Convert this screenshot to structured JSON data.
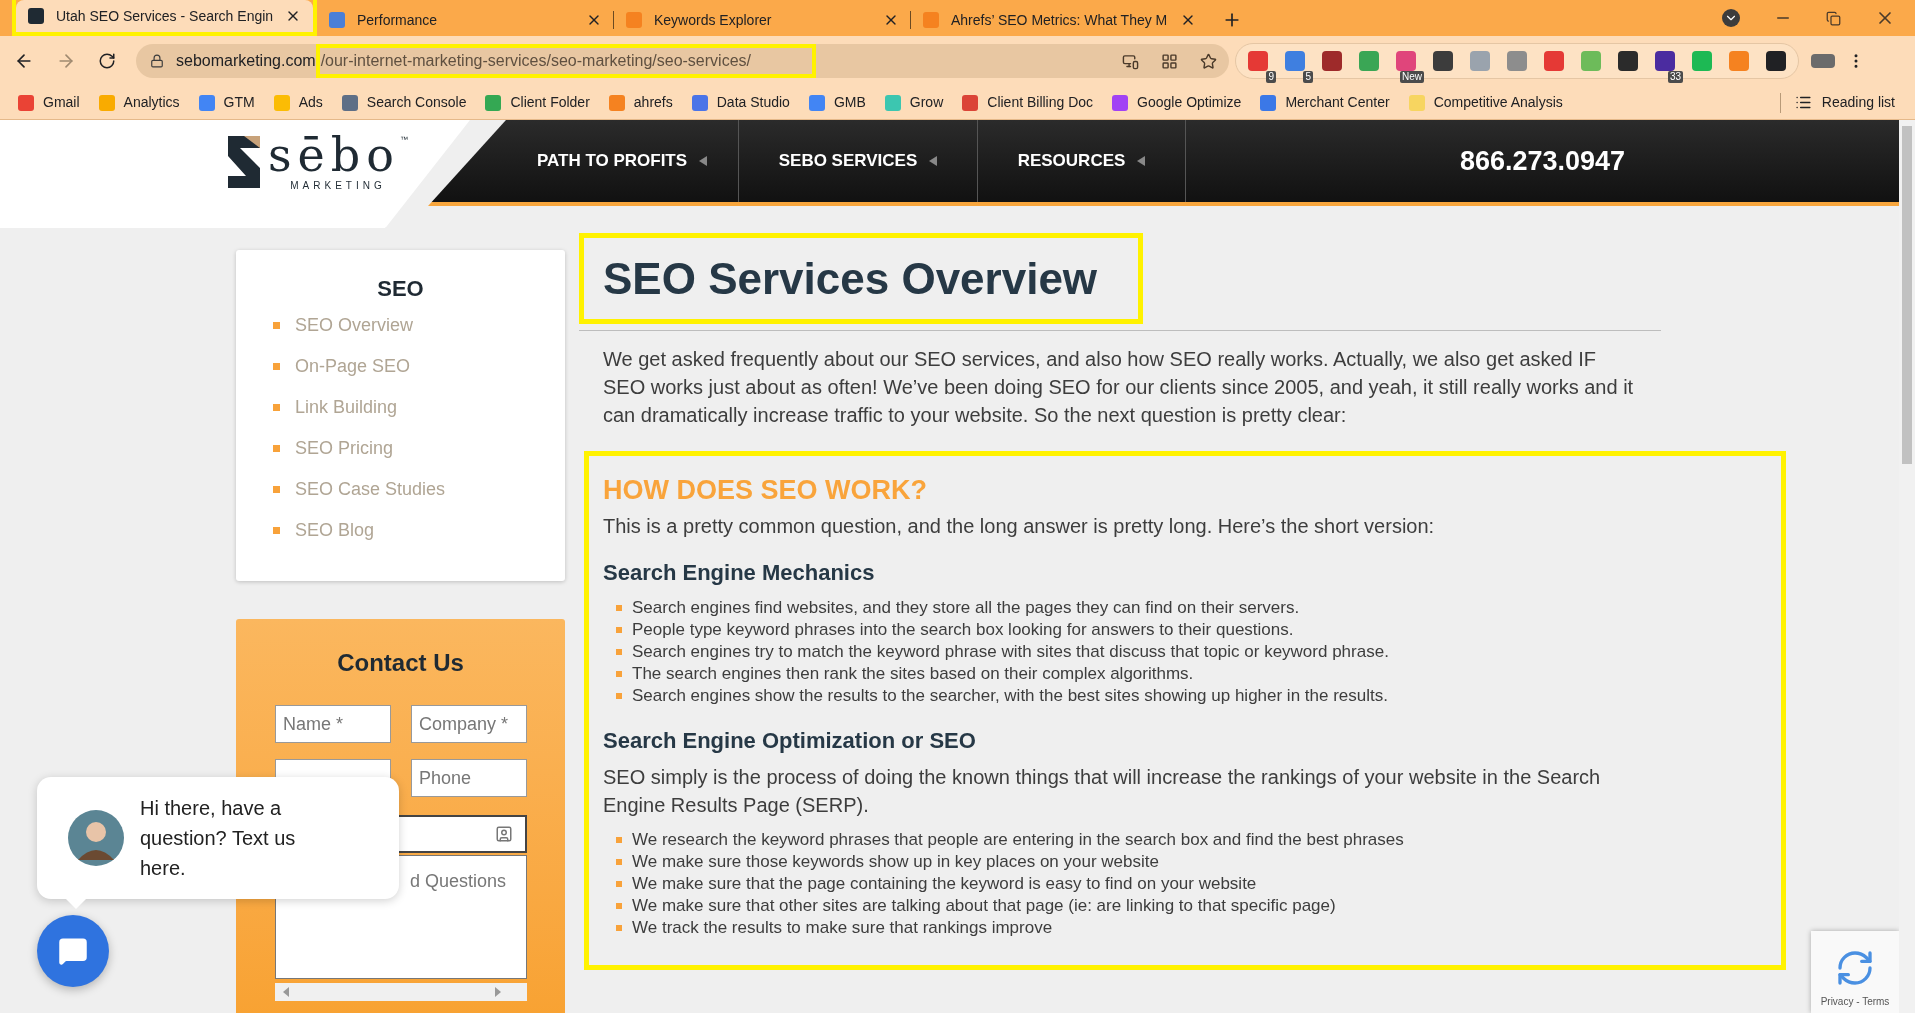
{
  "browser": {
    "tabs": [
      {
        "title": "Utah SEO Services - Search Engin",
        "selected": true,
        "color": "#1f2a33"
      },
      {
        "title": "Performance",
        "selected": false,
        "color": "#4a7fd6"
      },
      {
        "title": "Keywords Explorer",
        "selected": false,
        "color": "#f58220"
      },
      {
        "title": "Ahrefs’ SEO Metrics: What They M",
        "selected": false,
        "color": "#f58220"
      }
    ],
    "address": {
      "domain": "sebomarketing.com",
      "path": "/our-internet-marketing-services/seo-marketing/seo-services/"
    },
    "extensions": [
      {
        "color": "#e53935",
        "badge": "9"
      },
      {
        "color": "#3f7fe0",
        "badge": "5"
      },
      {
        "color": "#9e2a2a"
      },
      {
        "color": "#3aa655"
      },
      {
        "color": "#e0457b",
        "badge": "New"
      },
      {
        "color": "#3c3c3c"
      },
      {
        "color": "#9aa3ad"
      },
      {
        "color": "#8d8d8d"
      },
      {
        "color": "#e53935"
      },
      {
        "color": "#6dbb5a"
      },
      {
        "color": "#2b2b2b"
      },
      {
        "color": "#4b2ca0",
        "badge": "33"
      },
      {
        "color": "#1db954"
      },
      {
        "color": "#f58220"
      },
      {
        "color": "#202124"
      }
    ],
    "bookmarks": [
      {
        "label": "Gmail",
        "color": "#ea4335"
      },
      {
        "label": "Analytics",
        "color": "#f9ab00"
      },
      {
        "label": "GTM",
        "color": "#4285f4"
      },
      {
        "label": "Ads",
        "color": "#fbbc04"
      },
      {
        "label": "Search Console",
        "color": "#5f6f86"
      },
      {
        "label": "Client Folder",
        "color": "#34a853"
      },
      {
        "label": "ahrefs",
        "color": "#f58220"
      },
      {
        "label": "Data Studio",
        "color": "#4a74e8"
      },
      {
        "label": "GMB",
        "color": "#4285f4"
      },
      {
        "label": "Grow",
        "color": "#3cc6b0"
      },
      {
        "label": "Client Billing Doc",
        "color": "#db4437"
      },
      {
        "label": "Google Optimize",
        "color": "#a142f4"
      },
      {
        "label": "Merchant Center",
        "color": "#3b78e7"
      },
      {
        "label": "Competitive Analysis",
        "color": "#f7d560"
      }
    ],
    "reading_list": "Reading list"
  },
  "site": {
    "logo": {
      "wordmark": "sēbo",
      "trademark": "™",
      "tagline": "MARKETING"
    },
    "nav": [
      "PATH TO PROFITS",
      "SEBO SERVICES",
      "RESOURCES"
    ],
    "phone": "866.273.0947",
    "sidebar": {
      "title": "SEO",
      "items": [
        "SEO Overview",
        "On-Page SEO",
        "Link Building",
        "SEO Pricing",
        "SEO Case Studies",
        "SEO Blog"
      ]
    },
    "contact": {
      "title": "Contact Us",
      "fields": [
        {
          "kind": "text",
          "placeholder": "Name *"
        },
        {
          "kind": "text",
          "placeholder": "Company *"
        },
        {
          "kind": "text"
        },
        {
          "kind": "text",
          "placeholder": "Phone"
        },
        {
          "kind": "icon-field"
        },
        {
          "kind": "textarea",
          "placeholder": "d Questions"
        }
      ]
    },
    "content": {
      "title": "SEO Services Overview",
      "intro": "We get asked frequently about our SEO services, and also how SEO really works. Actually, we also get asked IF SEO works just about as often! We’ve been doing SEO for our clients since 2005, and yeah, it still really works and it can dramatically increase traffic to your website. So the next question is pretty clear:",
      "section_title": "HOW DOES SEO WORK?",
      "lead": "This is a pretty common question, and the long answer is pretty long. Here’s the short version:",
      "blocks": [
        {
          "kind": "heading",
          "text": "Search Engine Mechanics"
        },
        {
          "kind": "list",
          "items": [
            "Search engines find websites, and they store all the pages they can find on their servers.",
            "People type keyword phrases into the search box looking for answers to their questions.",
            "Search engines try to match the keyword phrase with sites that discuss that topic or keyword phrase.",
            "The search engines then rank the sites based on their complex algorithms.",
            "Search engines show the results to the searcher, with the best sites showing up higher in the results."
          ]
        },
        {
          "kind": "heading",
          "text": "Search Engine Optimization or SEO"
        },
        {
          "kind": "paragraph",
          "text": "SEO simply is the process of doing the known things that will increase the rankings of your website in the Search Engine Results Page (SERP)."
        },
        {
          "kind": "list",
          "items": [
            "We research the keyword phrases that people are entering in the search box and find the best phrases",
            "We make sure those keywords show up in key places on your website",
            "We make sure that the page containing the keyword is easy to find on your website",
            "We make sure that other sites are talking about that page (ie: are linking to that specific page)",
            "We track the results to make sure that rankings improve"
          ]
        }
      ]
    },
    "chat": {
      "message": "Hi there, have a question? Text us here."
    },
    "recaptcha": {
      "links": "Privacy - Terms"
    }
  }
}
